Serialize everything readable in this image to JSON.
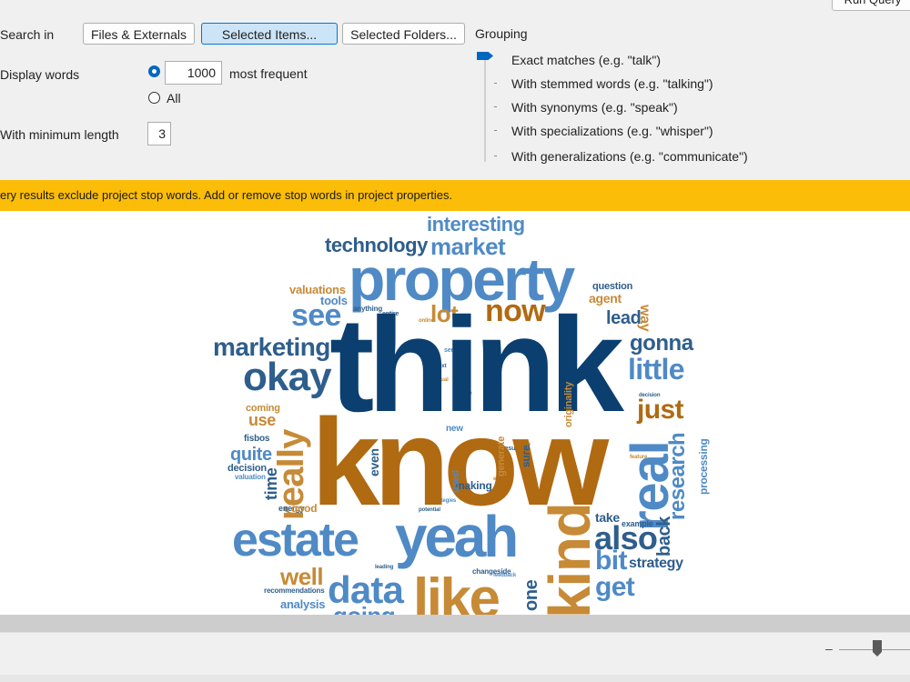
{
  "toolbar": {
    "run_query_label": "Run Query"
  },
  "options": {
    "search_in_label": "Search in",
    "files_externals_label": "Files & Externals",
    "selected_items_label": "Selected Items...",
    "selected_folders_label": "Selected Folders...",
    "display_words_label": "Display words",
    "display_count_value": "1000",
    "most_frequent_label": "most frequent",
    "all_label": "All",
    "min_length_label": "With minimum length",
    "min_length_value": "3"
  },
  "grouping": {
    "label": "Grouping",
    "options": [
      "Exact matches (e.g. \"talk\")",
      "With stemmed words (e.g. \"talking\")",
      "With synonyms (e.g. \"speak\")",
      "With specializations (e.g. \"whisper\")",
      "With generalizations (e.g. \"communicate\")"
    ],
    "selected_index": 0
  },
  "banner": {
    "text": "ery results exclude project stop words. Add or remove stop words in project properties."
  },
  "colors": {
    "dark_blue": "#0b3f70",
    "mid_blue": "#2e5e8c",
    "light_blue": "#4f8ac6",
    "dark_gold": "#b06a12",
    "gold": "#c78a36",
    "banner": "#fbbd08",
    "accent": "#0067c0"
  },
  "word_cloud": {
    "words": [
      {
        "text": "interesting"
      },
      {
        "text": "technology"
      },
      {
        "text": "market"
      },
      {
        "text": "property"
      },
      {
        "text": "question"
      },
      {
        "text": "agent"
      },
      {
        "text": "valuations"
      },
      {
        "text": "tools"
      },
      {
        "text": "anything"
      },
      {
        "text": "see"
      },
      {
        "text": "lot"
      },
      {
        "text": "now"
      },
      {
        "text": "lead"
      },
      {
        "text": "way"
      },
      {
        "text": "think"
      },
      {
        "text": "marketing"
      },
      {
        "text": "gonna"
      },
      {
        "text": "okay"
      },
      {
        "text": "little"
      },
      {
        "text": "coming"
      },
      {
        "text": "use"
      },
      {
        "text": "really"
      },
      {
        "text": "know"
      },
      {
        "text": "just"
      },
      {
        "text": "real"
      },
      {
        "text": "research"
      },
      {
        "text": "processing"
      },
      {
        "text": "fisbos"
      },
      {
        "text": "quite"
      },
      {
        "text": "decision"
      },
      {
        "text": "valuation"
      },
      {
        "text": "time"
      },
      {
        "text": "even"
      },
      {
        "text": "new"
      },
      {
        "text": "generate"
      },
      {
        "text": "originality"
      },
      {
        "text": "sure"
      },
      {
        "text": "making"
      },
      {
        "text": "used"
      },
      {
        "text": "energy"
      },
      {
        "text": "good"
      },
      {
        "text": "take"
      },
      {
        "text": "example"
      },
      {
        "text": "estate"
      },
      {
        "text": "yeah"
      },
      {
        "text": "kind"
      },
      {
        "text": "also"
      },
      {
        "text": "back"
      },
      {
        "text": "bit"
      },
      {
        "text": "strategy"
      },
      {
        "text": "well"
      },
      {
        "text": "data"
      },
      {
        "text": "changeside"
      },
      {
        "text": "one"
      },
      {
        "text": "like"
      },
      {
        "text": "get"
      },
      {
        "text": "recommendations"
      },
      {
        "text": "analysis"
      },
      {
        "text": "going"
      }
    ]
  }
}
